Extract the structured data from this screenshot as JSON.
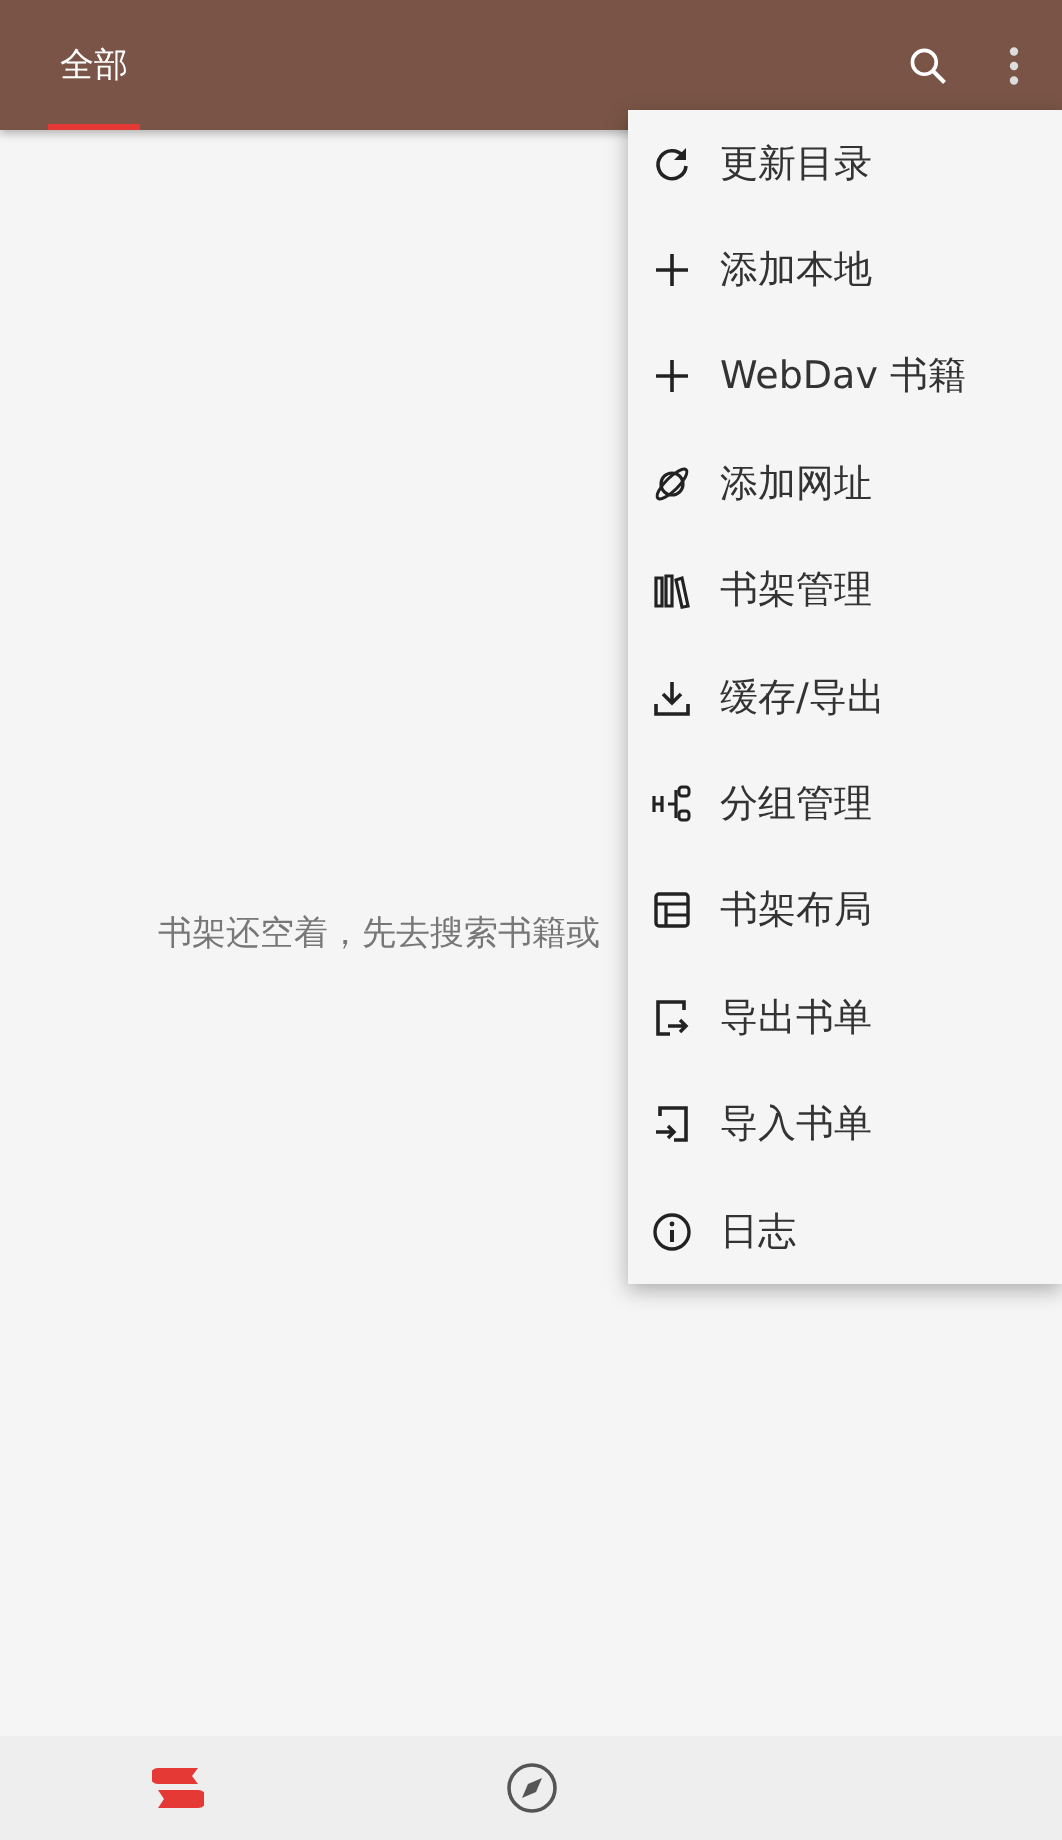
{
  "tabs": [
    {
      "label": "全部",
      "selected": true
    }
  ],
  "empty_message": "书架还空着，先去搜索书籍或",
  "menu": [
    {
      "kind": "refresh",
      "label": "更新目录"
    },
    {
      "kind": "plus",
      "label": "添加本地"
    },
    {
      "kind": "plus",
      "label": "WebDav 书籍"
    },
    {
      "kind": "planet",
      "label": "添加网址"
    },
    {
      "kind": "books",
      "label": "书架管理"
    },
    {
      "kind": "download",
      "label": "缓存/导出"
    },
    {
      "kind": "group",
      "label": "分组管理"
    },
    {
      "kind": "layout",
      "label": "书架布局"
    },
    {
      "kind": "export",
      "label": "导出书单"
    },
    {
      "kind": "import",
      "label": "导入书单"
    },
    {
      "kind": "info",
      "label": "日志"
    }
  ],
  "bottom_nav": [
    {
      "kind": "bookshelf",
      "selected": true
    },
    {
      "kind": "explore",
      "selected": false
    }
  ]
}
